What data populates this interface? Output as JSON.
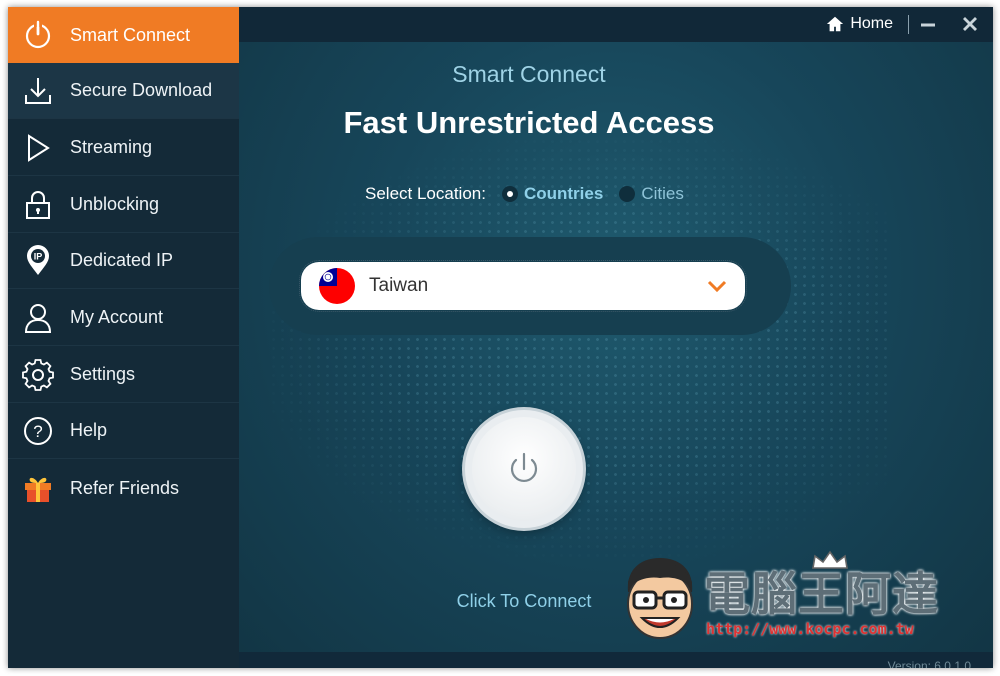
{
  "sidebar": {
    "items": [
      {
        "label": "Smart Connect",
        "icon": "power-icon"
      },
      {
        "label": "Secure Download",
        "icon": "download-icon"
      },
      {
        "label": "Streaming",
        "icon": "play-icon"
      },
      {
        "label": "Unblocking",
        "icon": "lock-icon"
      },
      {
        "label": "Dedicated IP",
        "icon": "ip-pin-icon"
      },
      {
        "label": "My Account",
        "icon": "user-icon"
      },
      {
        "label": "Settings",
        "icon": "gear-icon"
      },
      {
        "label": "Help",
        "icon": "help-icon"
      },
      {
        "label": "Refer Friends",
        "icon": "gift-icon"
      }
    ]
  },
  "titlebar": {
    "home_label": "Home"
  },
  "main": {
    "subtitle": "Smart Connect",
    "headline": "Fast Unrestricted Access",
    "location_label": "Select Location:",
    "option_countries": "Countries",
    "option_cities": "Cities",
    "selected_location": "Taiwan",
    "connect_label": "Click To Connect",
    "version": "Version: 6.0.1.0"
  },
  "watermark": {
    "title": "電腦王阿達",
    "url": "http://www.kocpc.com.tw"
  },
  "colors": {
    "accent": "#f07b24",
    "sidebar_bg": "#142a38",
    "main_bg": "#17465a",
    "link_blue": "#8fd0e8"
  }
}
